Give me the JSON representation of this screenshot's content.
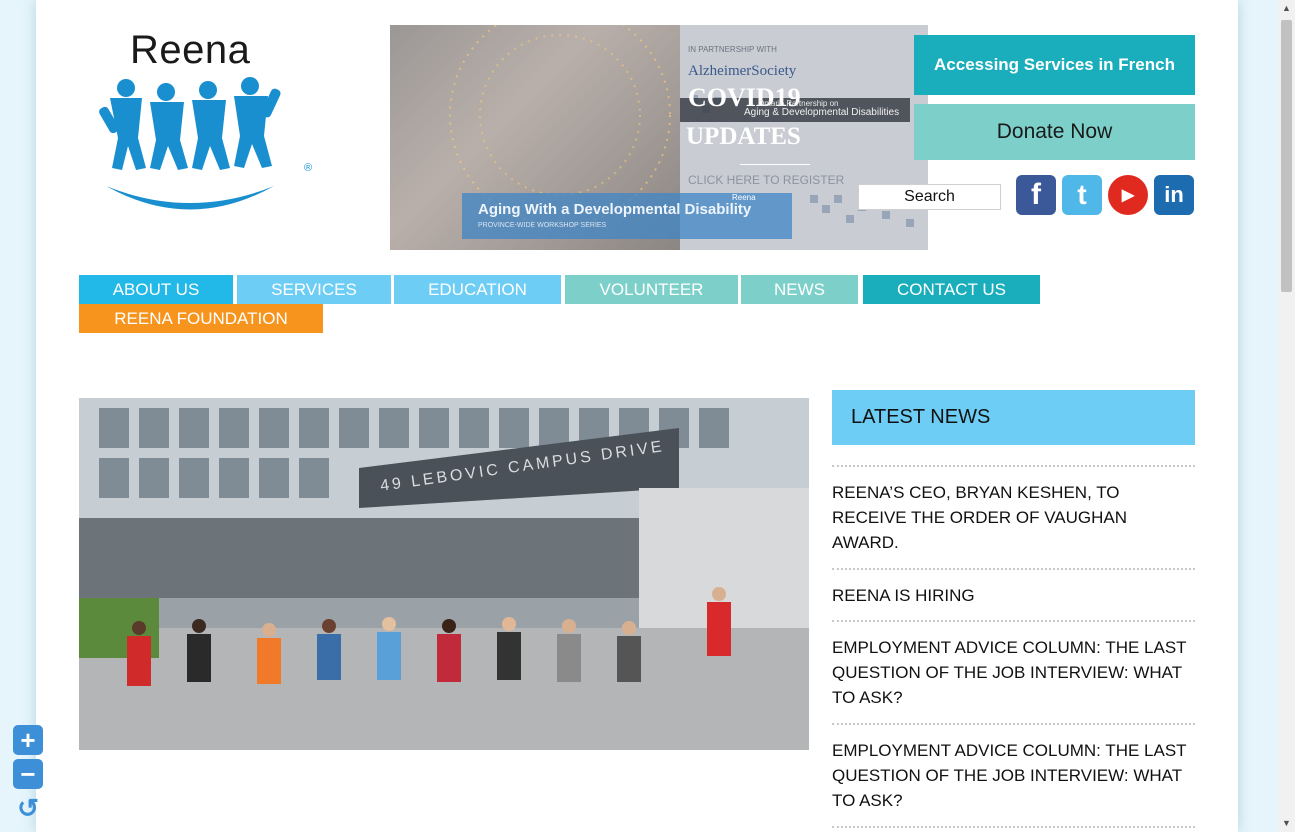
{
  "logo": {
    "text": "Reena",
    "registered": "®"
  },
  "banner": {
    "partnership": "IN PARTNERSHIP WITH",
    "alzheimer": "AlzheimerSociety",
    "title1": "COVID19",
    "title2": "UPDATES",
    "partner_line1": "Ontario Partnership on",
    "partner_line2": "Aging & Developmental Disabilities",
    "cta": "CLICK HERE TO REGISTER",
    "workshop": "Aging With a Developmental Disability",
    "workshop_sub": "PROVINCE-WIDE WORKSHOP SERIES",
    "mini_logo": "Reena"
  },
  "buttons": {
    "french": "Accessing Services in French",
    "donate": "Donate Now"
  },
  "search": {
    "label": "Search"
  },
  "social": [
    {
      "name": "facebook-icon",
      "glyph": "f",
      "color": "#3b5998"
    },
    {
      "name": "twitter-icon",
      "glyph": "t",
      "color": "#4fb8e8"
    },
    {
      "name": "youtube-icon",
      "glyph": "▶",
      "color": "#e02a20"
    },
    {
      "name": "linkedin-icon",
      "glyph": "in",
      "color": "#1d6cb0"
    }
  ],
  "nav": [
    {
      "label": "ABOUT US",
      "color": "#22b8e8"
    },
    {
      "label": "SERVICES",
      "color": "#6dcdf4"
    },
    {
      "label": "EDUCATION",
      "color": "#6dcdf4"
    },
    {
      "label": "VOLUNTEER",
      "color": "#7dd0ca"
    },
    {
      "label": "NEWS",
      "color": "#7dd0ca"
    },
    {
      "label": "CONTACT US",
      "color": "#1aaebc"
    },
    {
      "label": "REENA FOUNDATION",
      "color": "#f7941d"
    }
  ],
  "hero": {
    "sign": "49 LEBOVIC CAMPUS DRIVE"
  },
  "news": {
    "heading": "LATEST NEWS",
    "items": [
      "REENA’S CEO, BRYAN KESHEN, TO RECEIVE THE ORDER OF VAUGHAN AWARD.",
      "REENA IS HIRING",
      "EMPLOYMENT ADVICE COLUMN: THE LAST QUESTION OF THE JOB INTERVIEW: WHAT TO ASK?",
      "EMPLOYMENT ADVICE COLUMN: THE LAST QUESTION OF THE JOB INTERVIEW: WHAT TO ASK?"
    ]
  },
  "zoom": {
    "plus": "+",
    "minus": "−",
    "reset": "↺"
  },
  "scrollbar": {
    "up": "▲",
    "down": "▼"
  }
}
